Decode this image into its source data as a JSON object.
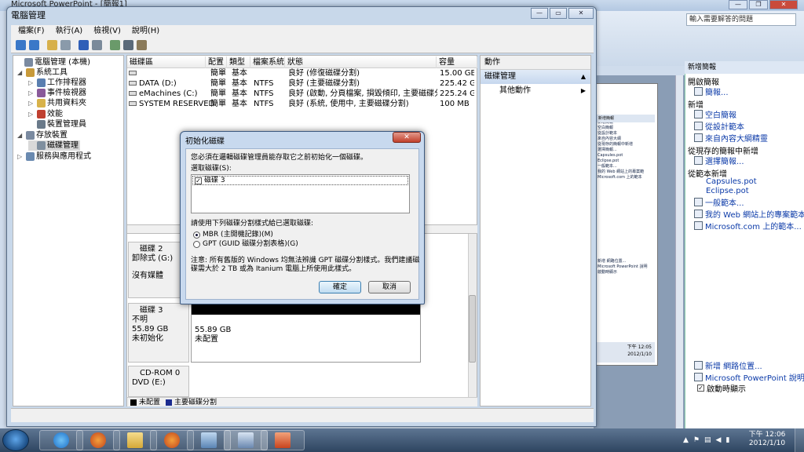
{
  "powerpoint": {
    "title": "Microsoft PowerPoint - [簡報1]",
    "help_placeholder": "輸入需要解答的問題",
    "taskpane": {
      "title": "新增簡報",
      "sec_open": "開啟簡報",
      "open_link": "簡報...",
      "sec_new": "新增",
      "new_links": [
        "空白簡報",
        "從設計範本",
        "來自內容大綱精靈"
      ],
      "sec_existing": "從現存的簡報中新增",
      "existing_link": "選擇簡報...",
      "sec_template": "從範本新增",
      "template_links": [
        "Capsules.pot",
        "Eclipse.pot",
        "一般範本...",
        "我的 Web 網站上的專案範本...",
        "Microsoft.com 上的範本..."
      ],
      "bottom_links": [
        "新增 網路位置...",
        "Microsoft PowerPoint 說明"
      ],
      "startup_label": "啟動時顯示"
    },
    "slide_lines": [
      "新增簡報",
      "空白簡報",
      "從設計範本",
      "來自內容大綱",
      "從現存的簡報中新增",
      "選擇簡報...",
      "Capsules.pot",
      "Eclipse.pot",
      "一般範本...",
      "我的 Web 網站上的專案範",
      "Microsoft.com 上的範本",
      "新增 網路位置...",
      "Microsoft PowerPoint 說明",
      "啟動時顯示"
    ],
    "slide_clock": [
      "下午 12:05",
      "2012/1/10"
    ]
  },
  "cm": {
    "title": "電腦管理",
    "menu": [
      "檔案(F)",
      "執行(A)",
      "檢視(V)",
      "說明(H)"
    ],
    "tree": [
      {
        "label": "電腦管理 (本機)",
        "arrow": "",
        "color": "#7a8aa0"
      },
      {
        "label": "系統工具",
        "arrow": "◢",
        "color": "#c89a3a"
      },
      {
        "label": "工作排程器",
        "arrow": "▷",
        "color": "#5a7fb0"
      },
      {
        "label": "事件檢視器",
        "arrow": "▷",
        "color": "#8a5a9a"
      },
      {
        "label": "共用資料夾",
        "arrow": "▷",
        "color": "#d8b24a"
      },
      {
        "label": "效能",
        "arrow": "▷",
        "color": "#c04030"
      },
      {
        "label": "裝置管理員",
        "arrow": "",
        "color": "#6a7a8a"
      },
      {
        "label": "存放裝置",
        "arrow": "◢",
        "color": "#7a8aa0"
      },
      {
        "label": "磁碟管理",
        "arrow": "",
        "color": "#7f8f9f"
      },
      {
        "label": "服務與應用程式",
        "arrow": "▷",
        "color": "#6a8ab0"
      }
    ],
    "vol_columns": [
      "磁碟區",
      "配置",
      "類型",
      "檔案系統",
      "狀態",
      "容量"
    ],
    "volumes": [
      {
        "name": "",
        "layout": "簡單",
        "type": "基本",
        "fs": "",
        "status": "良好 (修復磁碟分割)",
        "cap": "15.00 GB"
      },
      {
        "name": "DATA (D:)",
        "layout": "簡單",
        "type": "基本",
        "fs": "NTFS",
        "status": "良好 (主要磁碟分割)",
        "cap": "225.42 GB"
      },
      {
        "name": "eMachines (C:)",
        "layout": "簡單",
        "type": "基本",
        "fs": "NTFS",
        "status": "良好 (啟動, 分頁檔案, 損毀傾印, 主要磁碟分割)",
        "cap": "225.24 GB"
      },
      {
        "name": "SYSTEM RESERVED",
        "layout": "簡單",
        "type": "基本",
        "fs": "NTFS",
        "status": "良好 (系統, 使用中, 主要磁碟分割)",
        "cap": "100 MB"
      }
    ],
    "disk2": {
      "name": "磁碟 2",
      "type": "卸除式 (G:)",
      "media": "沒有媒體"
    },
    "disk3": {
      "name": "磁碟 3",
      "state": "不明",
      "size": "55.89 GB",
      "init": "未初始化",
      "part_size": "55.89 GB",
      "part_state": "未配置"
    },
    "cdrom": {
      "name": "CD-ROM 0",
      "drive": "DVD (E:)"
    },
    "legend": {
      "unalloc": "未配置",
      "primary": "主要磁碟分割",
      "unalloc_color": "#000000",
      "primary_color": "#1a2b8f"
    },
    "actions": {
      "header": "動作",
      "section": "磁碟管理",
      "other": "其他動作"
    }
  },
  "dialog": {
    "title": "初始化磁碟",
    "close": "✕",
    "intro": "您必須在邏輯磁碟管理員能存取它之前初始化一個磁碟。",
    "select_label": "選取磁碟(S):",
    "disk_item": "磁碟 3",
    "style_label": "請使用下列磁碟分割樣式給已選取磁碟:",
    "mbr": "MBR (主開機記錄)(M)",
    "gpt": "GPT (GUID 磁碟分割表格)(G)",
    "note_1": "注意: 所有舊版的 Windows 均無法辨識 GPT 磁碟分割樣式。我們建議磁",
    "note_2": "碟需大於 2 TB 或為 Itanium 電腦上所使用此樣式。",
    "ok": "確定",
    "cancel": "取消"
  },
  "taskbar": {
    "time": "下午 12:06",
    "date": "2012/1/10",
    "tray_label": "▲"
  }
}
